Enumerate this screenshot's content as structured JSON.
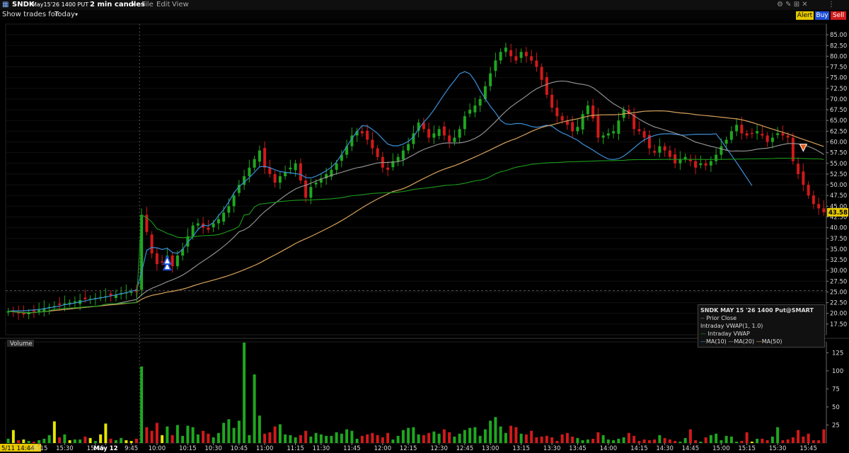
{
  "toolbar": {
    "symbol": "SNDK",
    "contract": "May15'26 1400 PUT",
    "interval": "2 min candles",
    "menus": [
      "File",
      "Edit",
      "View"
    ],
    "alert_label": "Alert",
    "buy_label": "Buy",
    "sell_label": "Sell",
    "show_trades_label": "Show trades for:",
    "show_trades_value": "Today"
  },
  "price_tag": "43.58",
  "legend": {
    "title": "SNDK MAY 15 '26 1400 Put@SMART",
    "prior_close": "Prior Close",
    "vwap_study": "Intraday VWAP(1, 1.0)",
    "vwap_line": "Intraday VWAP",
    "ma10": "MA(10)",
    "ma20": "MA(20)",
    "ma50": "MA(50)"
  },
  "volume_label": "Volume",
  "colors": {
    "up": "#1fa71f",
    "down": "#d11a1a",
    "flat": "#e6e600",
    "ma10": "#3b8fd9",
    "ma20": "#9a9a9a",
    "ma50": "#d7a25b",
    "vwap": "#1c9a1c",
    "accent": "#e6c800"
  },
  "chart_data": [
    {
      "type": "candlestick",
      "title": "SNDK MAY 15 '26 1400 Put@SMART",
      "ylim": [
        15,
        87.5
      ],
      "y_ticks": [
        "85.00",
        "82.50",
        "80.00",
        "77.50",
        "75.00",
        "72.50",
        "70.00",
        "67.50",
        "65.00",
        "62.50",
        "60.00",
        "57.50",
        "55.00",
        "52.50",
        "50.00",
        "47.50",
        "45.00",
        "42.50",
        "40.00",
        "37.50",
        "35.00",
        "32.50",
        "30.00",
        "27.50",
        "25.00",
        "22.50",
        "20.00",
        "17.50"
      ],
      "x_ticks": [
        "5/11 14:44",
        "15:15",
        "15:30",
        "15:45",
        "May 12",
        "9:45",
        "10:00",
        "10:15",
        "10:30",
        "10:45",
        "11:00",
        "11:15",
        "11:30",
        "11:45",
        "12:00",
        "12:15",
        "12:30",
        "12:45",
        "13:00",
        "13:15",
        "13:30",
        "13:45",
        "14:00",
        "14:15",
        "14:30",
        "14:45",
        "15:00",
        "15:15",
        "15:30",
        "15:45"
      ],
      "last_price": 43.58,
      "prior_close": 25.3,
      "close": [
        20.5,
        20.3,
        20.0,
        19.8,
        20.2,
        20.4,
        21.0,
        21.2,
        21.5,
        21.7,
        22.0,
        22.3,
        22.5,
        22.8,
        23.1,
        23.3,
        23.4,
        23.6,
        23.8,
        24.0,
        24.2,
        24.4,
        24.7,
        24.9,
        25.0,
        25.0,
        43.0,
        39.0,
        34.0,
        31.5,
        32.0,
        33.5,
        31.0,
        33.5,
        35.0,
        38.0,
        40.5,
        41.0,
        40.0,
        39.5,
        41.0,
        42.0,
        43.5,
        45.0,
        47.5,
        50.0,
        52.0,
        54.0,
        56.0,
        58.0,
        54.0,
        52.5,
        50.5,
        52.0,
        53.0,
        54.0,
        55.0,
        51.0,
        47.0,
        49.5,
        50.5,
        51.5,
        52.5,
        53.5,
        55.0,
        57.0,
        59.0,
        61.5,
        62.5,
        62.0,
        60.5,
        58.5,
        56.5,
        54.0,
        53.5,
        55.5,
        56.5,
        58.0,
        59.5,
        62.0,
        64.5,
        63.0,
        61.0,
        62.0,
        63.0,
        61.5,
        60.0,
        61.0,
        63.0,
        66.0,
        67.5,
        68.5,
        70.0,
        73.0,
        76.0,
        79.0,
        81.0,
        82.0,
        80.0,
        79.0,
        81.0,
        80.0,
        79.0,
        77.5,
        74.5,
        71.0,
        68.0,
        66.0,
        65.0,
        64.0,
        62.5,
        63.5,
        66.5,
        68.5,
        65.5,
        61.0,
        61.5,
        62.0,
        62.5,
        65.0,
        67.5,
        66.5,
        63.0,
        62.5,
        61.0,
        58.5,
        57.5,
        59.0,
        58.0,
        56.5,
        55.0,
        56.0,
        56.5,
        55.5,
        54.0,
        55.0,
        54.5,
        55.5,
        57.0,
        59.0,
        60.5,
        62.5,
        64.0,
        62.0,
        61.5,
        62.0,
        62.5,
        61.5,
        60.0,
        61.0,
        62.0,
        61.5,
        61.0,
        55.5,
        52.5,
        50.0,
        47.5,
        45.5,
        44.5,
        43.6
      ],
      "ma10": [
        20.5,
        20.6,
        20.6,
        20.6,
        20.7,
        20.8,
        20.9,
        21.1,
        21.3,
        21.5,
        21.7,
        22.0,
        22.2,
        22.4,
        22.7,
        22.9,
        23.2,
        23.4,
        23.6,
        23.8,
        24.1,
        24.3,
        24.6,
        24.8,
        25.2,
        25.4,
        29.6,
        34.7,
        35.4,
        35.3,
        34.9,
        35.2,
        34.2,
        34.0,
        34.9,
        36.6,
        37.9,
        39.6,
        40.6,
        40.4,
        41.2,
        42.8,
        44.2,
        46.0,
        48.1,
        49.6,
        50.6,
        51.7,
        52.9,
        54.2,
        54.3,
        54.0,
        53.5,
        53.1,
        52.9,
        52.8,
        52.6,
        52.4,
        51.7,
        51.6,
        52.0,
        52.6,
        53.3,
        54.1,
        55.3,
        57.1,
        58.9,
        60.8,
        62.4,
        63.8,
        63.7,
        62.9,
        62.0,
        60.7,
        59.5,
        59.1,
        59.1,
        59.5,
        60.1,
        61.2,
        63.0,
        64.6,
        65.9,
        67.5,
        69.3,
        71.1,
        72.8,
        74.3,
        75.9,
        76.4,
        75.9,
        74.2,
        72.0,
        70.1,
        68.3,
        66.8,
        65.0,
        64.2,
        64.1,
        64.3,
        64.3,
        64.0,
        63.6,
        63.4,
        63.6,
        63.9,
        63.7,
        62.8,
        62.1,
        61.6,
        61.0,
        60.4,
        59.5,
        58.8,
        58.1,
        57.3,
        56.6,
        56.0,
        55.9,
        56.1,
        56.7,
        57.6,
        58.6,
        59.6,
        60.5,
        61.1,
        61.5,
        61.8,
        61.9,
        61.9,
        61.8,
        61.6,
        61.6,
        61.7,
        61.8,
        61.8,
        61.8,
        61.8,
        61.9,
        60.3,
        58.6,
        56.9,
        55.2,
        53.4,
        51.6,
        49.8
      ]
    },
    {
      "type": "bar",
      "title": "Volume",
      "ylim": [
        0,
        140
      ],
      "y_ticks": [
        "125",
        "100",
        "75",
        "50",
        "25"
      ],
      "values": [
        6,
        18,
        4,
        5,
        3,
        2,
        4,
        6,
        11,
        30,
        8,
        12,
        4,
        5,
        5,
        9,
        7,
        3,
        12,
        27,
        6,
        4,
        7,
        4,
        3,
        6,
        106,
        22,
        17,
        28,
        11,
        23,
        11,
        25,
        10,
        24,
        22,
        12,
        17,
        13,
        8,
        14,
        28,
        33,
        21,
        31,
        139,
        11,
        95,
        38,
        13,
        15,
        23,
        26,
        12,
        11,
        8,
        11,
        17,
        9,
        14,
        12,
        10,
        10,
        15,
        13,
        19,
        17,
        6,
        10,
        12,
        14,
        11,
        8,
        14,
        5,
        10,
        18,
        21,
        22,
        12,
        11,
        14,
        16,
        13,
        19,
        15,
        9,
        13,
        18,
        21,
        22,
        10,
        19,
        31,
        36,
        23,
        14,
        24,
        22,
        13,
        12,
        17,
        8,
        9,
        10,
        8,
        3,
        12,
        14,
        9,
        7,
        4,
        5,
        6,
        15,
        11,
        5,
        4,
        6,
        8,
        14,
        10,
        3,
        5,
        4,
        5,
        11,
        7,
        5,
        3,
        2,
        7,
        19,
        4,
        2,
        8,
        11,
        13,
        4,
        10,
        9,
        2,
        3,
        15,
        2,
        6,
        6,
        4,
        9,
        22,
        4,
        5,
        8,
        18,
        9,
        13,
        4,
        4,
        19,
        6,
        9
      ],
      "colors": "up/down match price candles; yellow = unchanged"
    }
  ]
}
